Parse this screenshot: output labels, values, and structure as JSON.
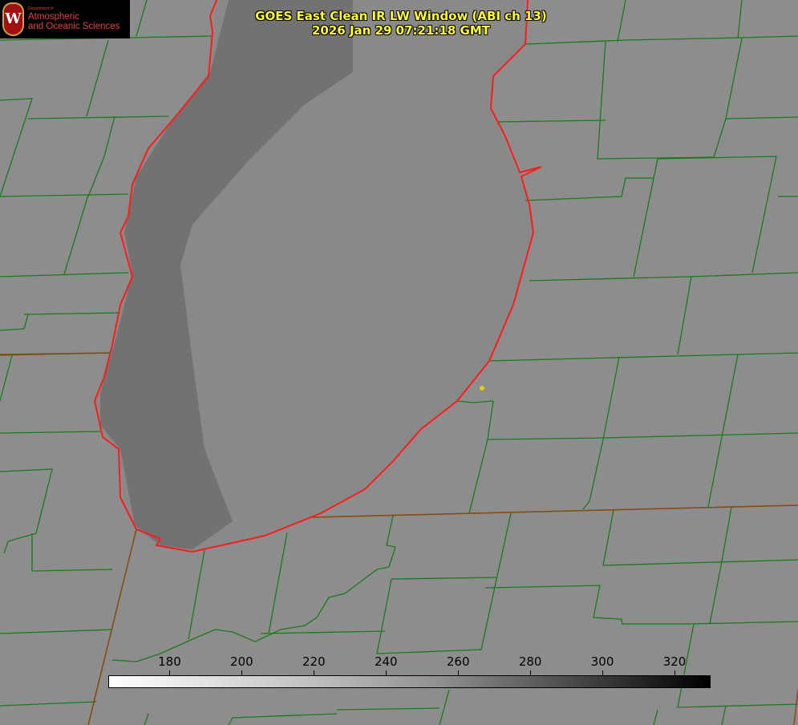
{
  "title": {
    "line1": "GOES East Clean IR LW Window (ABI ch 13)",
    "line2": "2026 Jan 29 07:21:18 GMT"
  },
  "logo": {
    "department": "Department of",
    "line1": "Atmospheric",
    "line2": "and Oceanic Sciences",
    "seal_letter": "W"
  },
  "colorbar": {
    "min": 163,
    "max": 330,
    "ticks": [
      "180",
      "200",
      "220",
      "240",
      "260",
      "280",
      "300",
      "320"
    ],
    "tick_values": [
      180,
      200,
      220,
      240,
      260,
      280,
      300,
      320
    ],
    "colormap": "white-to-black grayscale"
  },
  "colors": {
    "title": "#ffff33",
    "county_lines": "#1a7a1a",
    "shoreline": "#ff1a1a",
    "marker": "#e0d000"
  }
}
